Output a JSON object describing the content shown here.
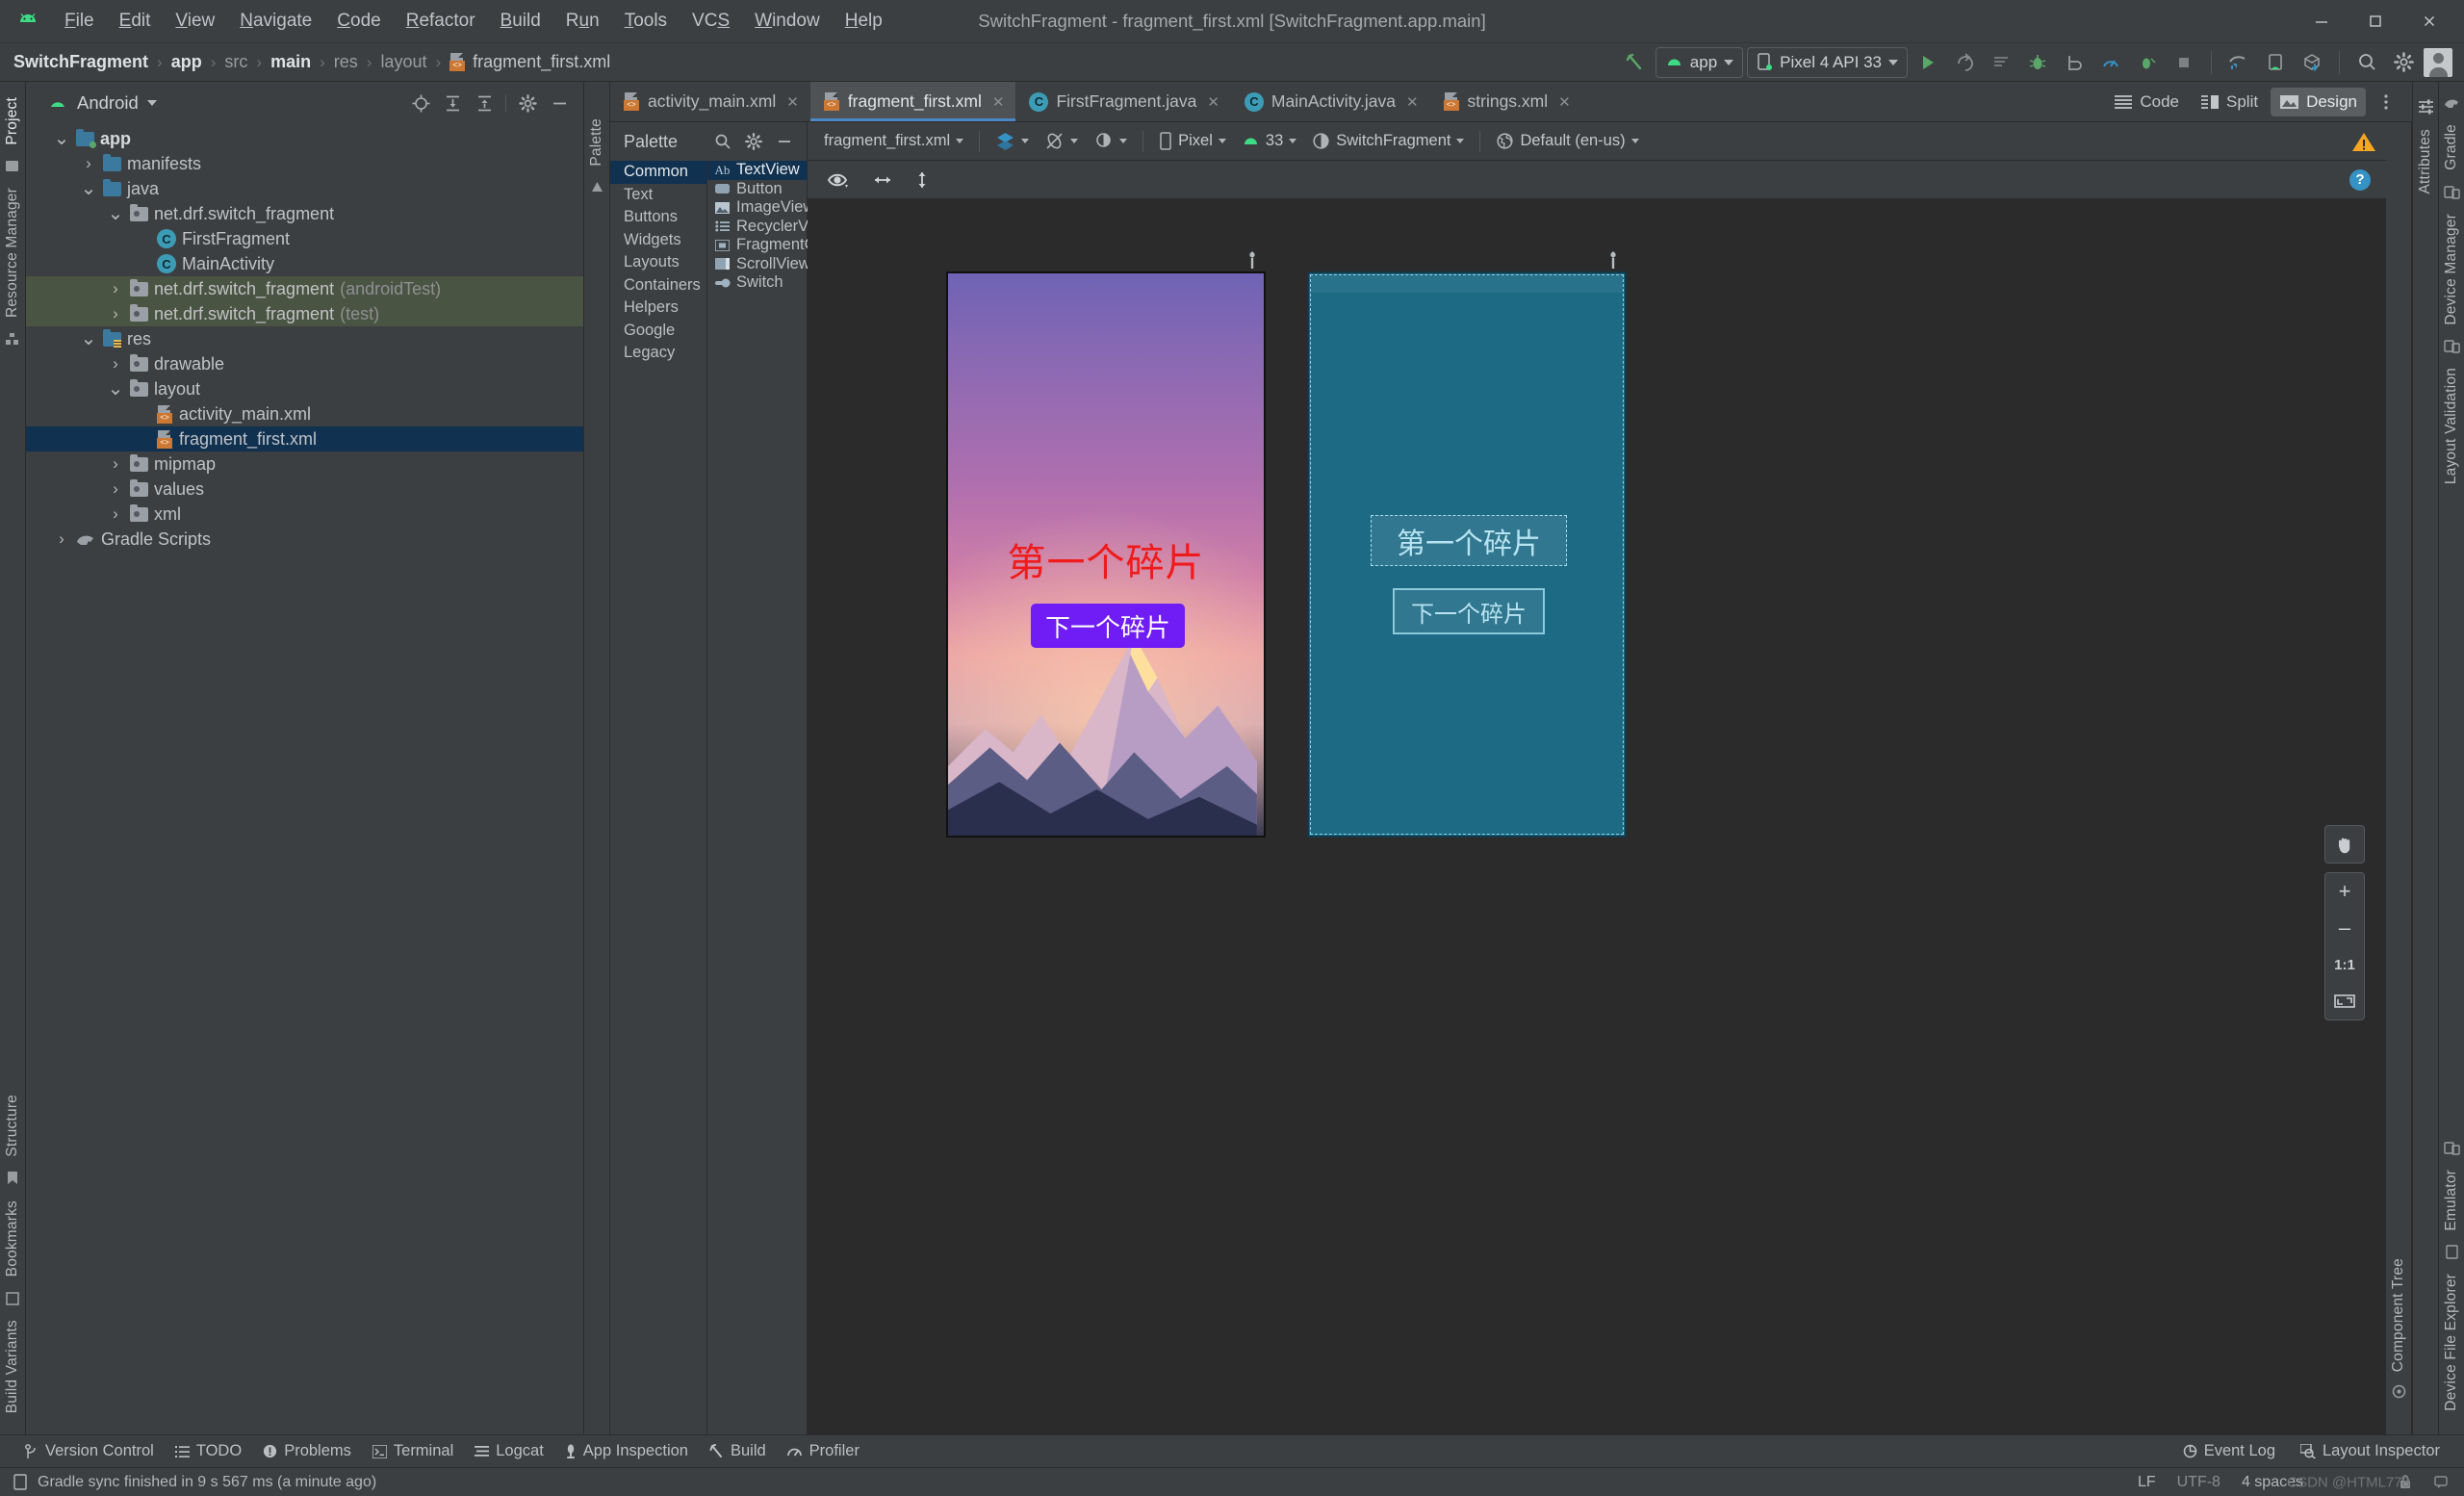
{
  "window": {
    "title": "SwitchFragment - fragment_first.xml [SwitchFragment.app.main]",
    "minimize_label": "—",
    "maximize_label": "❑",
    "close_label": "✕"
  },
  "menubar": {
    "items": [
      {
        "label": "File",
        "mnemonic": "F"
      },
      {
        "label": "Edit",
        "mnemonic": "E"
      },
      {
        "label": "View",
        "mnemonic": "V"
      },
      {
        "label": "Navigate",
        "mnemonic": "N"
      },
      {
        "label": "Code",
        "mnemonic": "C"
      },
      {
        "label": "Refactor",
        "mnemonic": "R"
      },
      {
        "label": "Build",
        "mnemonic": "B"
      },
      {
        "label": "Run",
        "mnemonic": "u"
      },
      {
        "label": "Tools",
        "mnemonic": "T"
      },
      {
        "label": "VCS",
        "mnemonic": "S"
      },
      {
        "label": "Window",
        "mnemonic": "W"
      },
      {
        "label": "Help",
        "mnemonic": "H"
      }
    ]
  },
  "breadcrumb": {
    "items": [
      "SwitchFragment",
      "app",
      "src",
      "main",
      "res",
      "layout"
    ],
    "file": "fragment_first.xml",
    "separator": "›"
  },
  "toolbar": {
    "module_selector": "app",
    "device_selector": "Pixel 4 API 33",
    "icons": [
      "build-hammer-icon",
      "run-icon",
      "apply-changes-icon",
      "apply-code-changes-icon",
      "debug-icon",
      "attach-debugger-icon",
      "profiler-icon",
      "run-with-coverage-icon",
      "stop-icon",
      "sync-gradle-icon",
      "avd-manager-icon",
      "sdk-manager-icon",
      "search-everywhere-icon",
      "settings-icon",
      "account-avatar-icon"
    ]
  },
  "left_strip": {
    "top_labels": [
      "Project"
    ],
    "labels": [
      "Resource Manager"
    ],
    "bottom_labels": [
      "Structure",
      "Bookmarks",
      "Build Variants"
    ]
  },
  "right_strip_inner": {
    "labels": [
      "Attributes"
    ]
  },
  "right_strip_outer": {
    "labels": [
      "Gradle",
      "Device Manager",
      "Layout Validation",
      "Emulator",
      "Device File Explorer"
    ]
  },
  "project_panel": {
    "title": "Android",
    "header_icons": [
      "select-opened-file-icon",
      "expand-all-icon",
      "collapse-all-icon",
      "settings-icon",
      "hide-icon"
    ],
    "tree": [
      {
        "label": "app",
        "indent": 0,
        "arrow": "down",
        "icon": "module-folder",
        "bold": true
      },
      {
        "label": "manifests",
        "indent": 1,
        "arrow": "right",
        "icon": "folder-blue"
      },
      {
        "label": "java",
        "indent": 1,
        "arrow": "down",
        "icon": "folder-blue"
      },
      {
        "label": "net.drf.switch_fragment",
        "indent": 2,
        "arrow": "down",
        "icon": "package"
      },
      {
        "label": "FirstFragment",
        "indent": 3,
        "arrow": "none",
        "icon": "class"
      },
      {
        "label": "MainActivity",
        "indent": 3,
        "arrow": "none",
        "icon": "class"
      },
      {
        "label": "net.drf.switch_fragment",
        "suffix": "(androidTest)",
        "indent": 2,
        "arrow": "right",
        "icon": "package",
        "highlight": "test"
      },
      {
        "label": "net.drf.switch_fragment",
        "suffix": "(test)",
        "indent": 2,
        "arrow": "right",
        "icon": "package",
        "highlight": "test"
      },
      {
        "label": "res",
        "indent": 1,
        "arrow": "down",
        "icon": "folder-res"
      },
      {
        "label": "drawable",
        "indent": 2,
        "arrow": "right",
        "icon": "package"
      },
      {
        "label": "layout",
        "indent": 2,
        "arrow": "down",
        "icon": "package"
      },
      {
        "label": "activity_main.xml",
        "indent": 3,
        "arrow": "none",
        "icon": "xml"
      },
      {
        "label": "fragment_first.xml",
        "indent": 3,
        "arrow": "none",
        "icon": "xml",
        "selected": true
      },
      {
        "label": "mipmap",
        "indent": 2,
        "arrow": "right",
        "icon": "package"
      },
      {
        "label": "values",
        "indent": 2,
        "arrow": "right",
        "icon": "package"
      },
      {
        "label": "xml",
        "indent": 2,
        "arrow": "right",
        "icon": "package"
      },
      {
        "label": "Gradle Scripts",
        "indent": 0,
        "arrow": "right",
        "icon": "gradle"
      }
    ]
  },
  "editor_tabs": [
    {
      "label": "activity_main.xml",
      "icon": "xml",
      "active": false
    },
    {
      "label": "fragment_first.xml",
      "icon": "xml",
      "active": true
    },
    {
      "label": "FirstFragment.java",
      "icon": "class",
      "active": false
    },
    {
      "label": "MainActivity.java",
      "icon": "class",
      "active": false
    },
    {
      "label": "strings.xml",
      "icon": "xml",
      "active": false
    }
  ],
  "editor_modes": [
    {
      "label": "Code",
      "active": false
    },
    {
      "label": "Split",
      "active": false
    },
    {
      "label": "Design",
      "active": true
    }
  ],
  "palette": {
    "title": "Palette",
    "header_icons": [
      "search-icon",
      "settings-icon",
      "hide-icon"
    ],
    "categories": [
      {
        "label": "Common",
        "selected": true
      },
      {
        "label": "Text",
        "selected": false
      },
      {
        "label": "Buttons",
        "selected": false
      },
      {
        "label": "Widgets",
        "selected": false
      },
      {
        "label": "Layouts",
        "selected": false
      },
      {
        "label": "Containers",
        "selected": false
      },
      {
        "label": "Helpers",
        "selected": false
      },
      {
        "label": "Google",
        "selected": false
      },
      {
        "label": "Legacy",
        "selected": false
      }
    ],
    "items": [
      {
        "label": "TextView",
        "icon": "textview-icon",
        "selected": true
      },
      {
        "label": "Button",
        "icon": "button-icon",
        "selected": false
      },
      {
        "label": "ImageView",
        "icon": "imageview-icon",
        "selected": false
      },
      {
        "label": "RecyclerVie...",
        "icon": "recyclerview-icon",
        "selected": false
      },
      {
        "label": "FragmentC...",
        "icon": "fragmentcontainer-icon",
        "selected": false
      },
      {
        "label": "ScrollView",
        "icon": "scrollview-icon",
        "selected": false
      },
      {
        "label": "Switch",
        "icon": "switch-icon",
        "selected": false
      }
    ]
  },
  "surface_toolbar": {
    "file_variant": "fragment_first.xml",
    "design_mode_icon": "design-surface-icon",
    "orientation_icon": "orientation-icon",
    "theme_icon": "theme-icon",
    "device": "Pixel",
    "api_level": "33",
    "theme": "SwitchFragment",
    "locale": "Default (en-us)",
    "warning_icon": "warning-triangle-icon",
    "help_icon": "help-icon",
    "view_icons": [
      "eye-visibility-icon",
      "horizontal-guide-icon",
      "vertical-guide-icon"
    ]
  },
  "preview": {
    "design": {
      "text_label": "第一个碎片",
      "button_label": "下一个碎片",
      "text_color": "#f01a1a",
      "button_bg": "#6f1cf5",
      "button_text_color": "#ffffff",
      "tools_icon": "wrench-icon"
    },
    "blueprint": {
      "text_label": "第一个碎片",
      "button_label": "下一个碎片",
      "bg_color": "#1c6a84",
      "outline_color": "#a5dcec",
      "tools_icon": "wrench-icon"
    }
  },
  "zoom_controls": {
    "pan_icon": "pan-hand-icon",
    "zoom_in": "+",
    "zoom_out": "–",
    "actual_size": "1:1",
    "zoom_to_fit_icon": "zoom-to-fit-icon"
  },
  "component_tree": {
    "label": "Component Tree"
  },
  "bottom_toolwindows": {
    "left": [
      {
        "label": "Version Control",
        "icon": "branch-icon"
      },
      {
        "label": "TODO",
        "icon": "todo-icon"
      },
      {
        "label": "Problems",
        "icon": "problems-icon"
      },
      {
        "label": "Terminal",
        "icon": "terminal-icon"
      },
      {
        "label": "Logcat",
        "icon": "logcat-icon"
      },
      {
        "label": "App Inspection",
        "icon": "app-inspection-icon"
      },
      {
        "label": "Build",
        "icon": "build-icon"
      },
      {
        "label": "Profiler",
        "icon": "profiler-icon"
      }
    ],
    "right": [
      {
        "label": "Event Log",
        "icon": "event-log-icon"
      },
      {
        "label": "Layout Inspector",
        "icon": "layout-inspector-icon"
      }
    ]
  },
  "statusbar": {
    "message": "Gradle sync finished in 9 s 567 ms (a minute ago)",
    "message_icon": "status-device-icon",
    "line_separator": "LF",
    "encoding": "UTF-8",
    "indent": "4 spaces",
    "watermark": "CSDN @HTML778",
    "right_icons": [
      "lock-icon",
      "notification-icon"
    ]
  }
}
